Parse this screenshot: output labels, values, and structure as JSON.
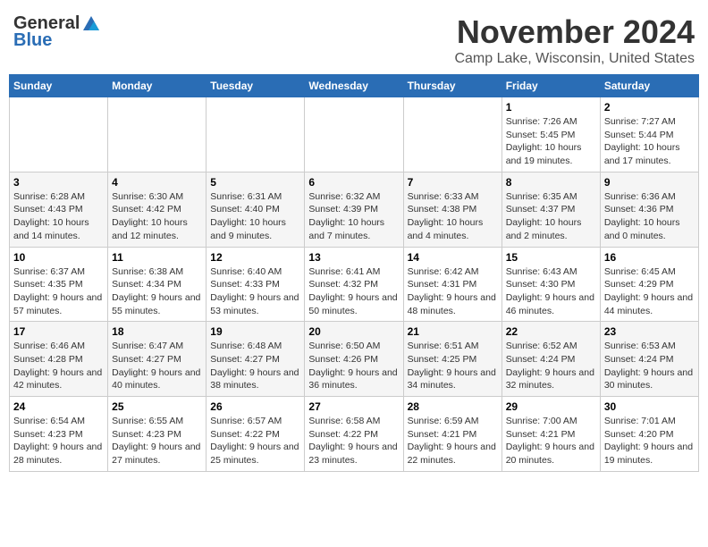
{
  "header": {
    "logo_general": "General",
    "logo_blue": "Blue",
    "month": "November 2024",
    "location": "Camp Lake, Wisconsin, United States"
  },
  "weekdays": [
    "Sunday",
    "Monday",
    "Tuesday",
    "Wednesday",
    "Thursday",
    "Friday",
    "Saturday"
  ],
  "weeks": [
    [
      {
        "day": "",
        "info": ""
      },
      {
        "day": "",
        "info": ""
      },
      {
        "day": "",
        "info": ""
      },
      {
        "day": "",
        "info": ""
      },
      {
        "day": "",
        "info": ""
      },
      {
        "day": "1",
        "info": "Sunrise: 7:26 AM\nSunset: 5:45 PM\nDaylight: 10 hours and 19 minutes."
      },
      {
        "day": "2",
        "info": "Sunrise: 7:27 AM\nSunset: 5:44 PM\nDaylight: 10 hours and 17 minutes."
      }
    ],
    [
      {
        "day": "3",
        "info": "Sunrise: 6:28 AM\nSunset: 4:43 PM\nDaylight: 10 hours and 14 minutes."
      },
      {
        "day": "4",
        "info": "Sunrise: 6:30 AM\nSunset: 4:42 PM\nDaylight: 10 hours and 12 minutes."
      },
      {
        "day": "5",
        "info": "Sunrise: 6:31 AM\nSunset: 4:40 PM\nDaylight: 10 hours and 9 minutes."
      },
      {
        "day": "6",
        "info": "Sunrise: 6:32 AM\nSunset: 4:39 PM\nDaylight: 10 hours and 7 minutes."
      },
      {
        "day": "7",
        "info": "Sunrise: 6:33 AM\nSunset: 4:38 PM\nDaylight: 10 hours and 4 minutes."
      },
      {
        "day": "8",
        "info": "Sunrise: 6:35 AM\nSunset: 4:37 PM\nDaylight: 10 hours and 2 minutes."
      },
      {
        "day": "9",
        "info": "Sunrise: 6:36 AM\nSunset: 4:36 PM\nDaylight: 10 hours and 0 minutes."
      }
    ],
    [
      {
        "day": "10",
        "info": "Sunrise: 6:37 AM\nSunset: 4:35 PM\nDaylight: 9 hours and 57 minutes."
      },
      {
        "day": "11",
        "info": "Sunrise: 6:38 AM\nSunset: 4:34 PM\nDaylight: 9 hours and 55 minutes."
      },
      {
        "day": "12",
        "info": "Sunrise: 6:40 AM\nSunset: 4:33 PM\nDaylight: 9 hours and 53 minutes."
      },
      {
        "day": "13",
        "info": "Sunrise: 6:41 AM\nSunset: 4:32 PM\nDaylight: 9 hours and 50 minutes."
      },
      {
        "day": "14",
        "info": "Sunrise: 6:42 AM\nSunset: 4:31 PM\nDaylight: 9 hours and 48 minutes."
      },
      {
        "day": "15",
        "info": "Sunrise: 6:43 AM\nSunset: 4:30 PM\nDaylight: 9 hours and 46 minutes."
      },
      {
        "day": "16",
        "info": "Sunrise: 6:45 AM\nSunset: 4:29 PM\nDaylight: 9 hours and 44 minutes."
      }
    ],
    [
      {
        "day": "17",
        "info": "Sunrise: 6:46 AM\nSunset: 4:28 PM\nDaylight: 9 hours and 42 minutes."
      },
      {
        "day": "18",
        "info": "Sunrise: 6:47 AM\nSunset: 4:27 PM\nDaylight: 9 hours and 40 minutes."
      },
      {
        "day": "19",
        "info": "Sunrise: 6:48 AM\nSunset: 4:27 PM\nDaylight: 9 hours and 38 minutes."
      },
      {
        "day": "20",
        "info": "Sunrise: 6:50 AM\nSunset: 4:26 PM\nDaylight: 9 hours and 36 minutes."
      },
      {
        "day": "21",
        "info": "Sunrise: 6:51 AM\nSunset: 4:25 PM\nDaylight: 9 hours and 34 minutes."
      },
      {
        "day": "22",
        "info": "Sunrise: 6:52 AM\nSunset: 4:24 PM\nDaylight: 9 hours and 32 minutes."
      },
      {
        "day": "23",
        "info": "Sunrise: 6:53 AM\nSunset: 4:24 PM\nDaylight: 9 hours and 30 minutes."
      }
    ],
    [
      {
        "day": "24",
        "info": "Sunrise: 6:54 AM\nSunset: 4:23 PM\nDaylight: 9 hours and 28 minutes."
      },
      {
        "day": "25",
        "info": "Sunrise: 6:55 AM\nSunset: 4:23 PM\nDaylight: 9 hours and 27 minutes."
      },
      {
        "day": "26",
        "info": "Sunrise: 6:57 AM\nSunset: 4:22 PM\nDaylight: 9 hours and 25 minutes."
      },
      {
        "day": "27",
        "info": "Sunrise: 6:58 AM\nSunset: 4:22 PM\nDaylight: 9 hours and 23 minutes."
      },
      {
        "day": "28",
        "info": "Sunrise: 6:59 AM\nSunset: 4:21 PM\nDaylight: 9 hours and 22 minutes."
      },
      {
        "day": "29",
        "info": "Sunrise: 7:00 AM\nSunset: 4:21 PM\nDaylight: 9 hours and 20 minutes."
      },
      {
        "day": "30",
        "info": "Sunrise: 7:01 AM\nSunset: 4:20 PM\nDaylight: 9 hours and 19 minutes."
      }
    ]
  ]
}
